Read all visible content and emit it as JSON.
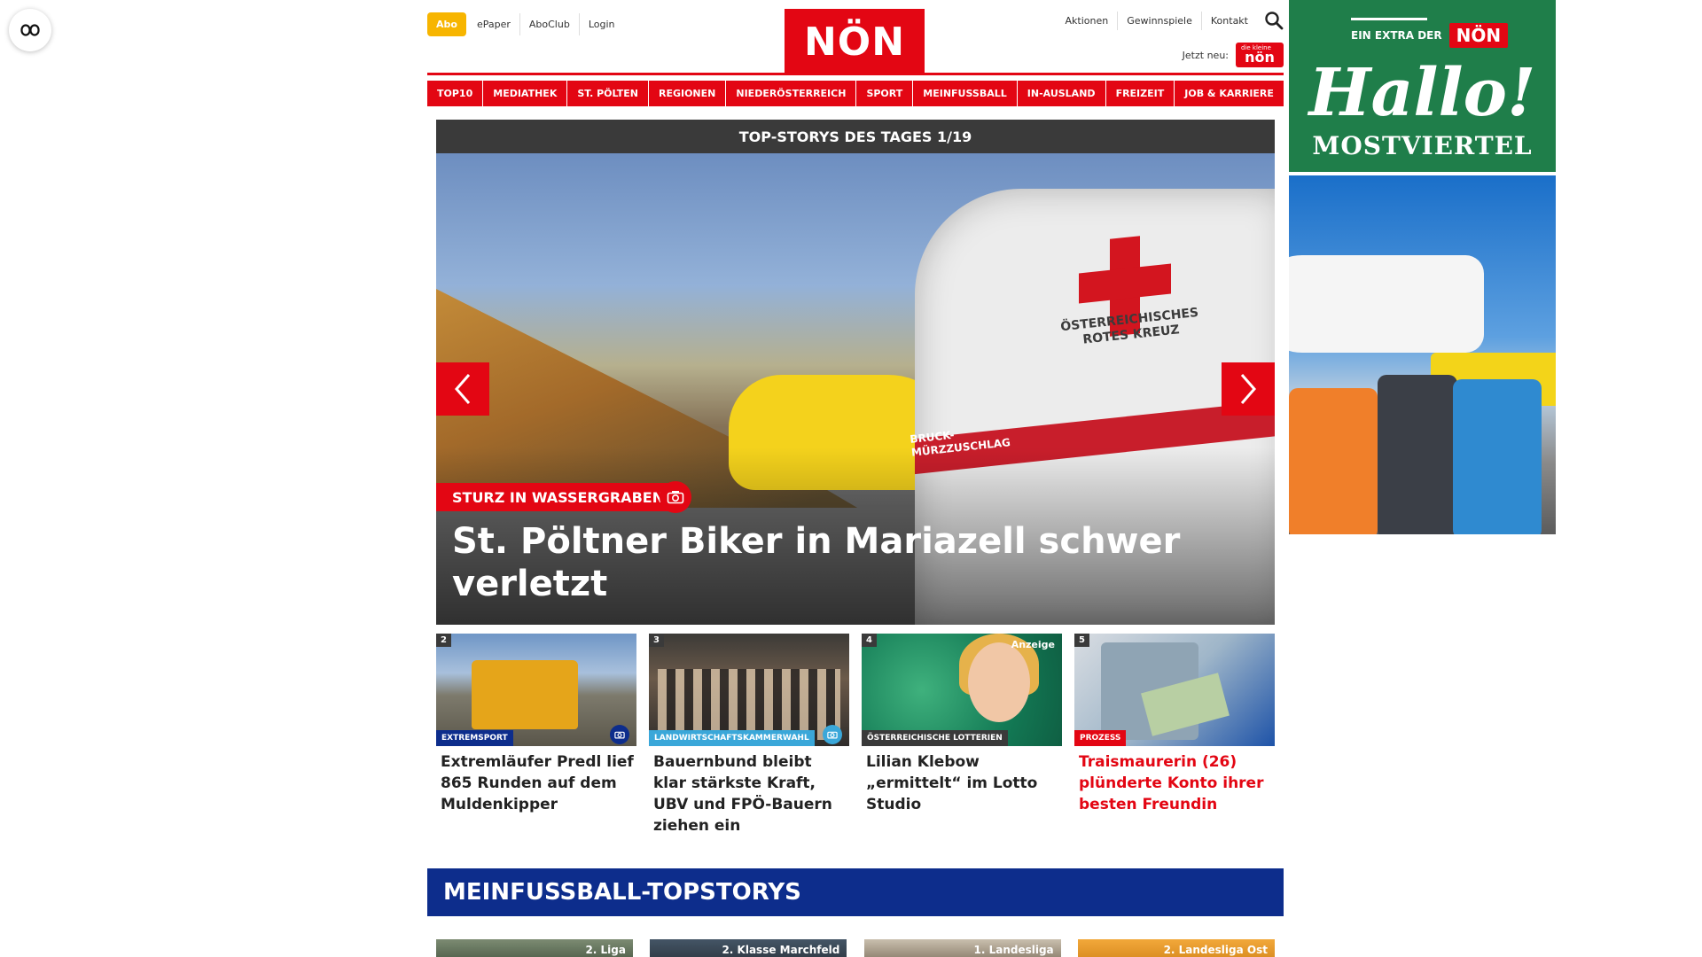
{
  "header": {
    "abo": "Abo",
    "left_links": [
      "ePaper",
      "AboClub",
      "Login"
    ],
    "logo": "NÖN",
    "right_links": [
      "Aktionen",
      "Gewinnspiele",
      "Kontakt"
    ],
    "jetzt_neu": "Jetzt neu:",
    "jetzt_badge": "nön",
    "jetzt_badge_small": "die kleine"
  },
  "nav": [
    "TOP10",
    "MEDIATHEK",
    "ST. PÖLTEN",
    "REGIONEN",
    "NIEDERÖSTERREICH",
    "SPORT",
    "MEINFUSSBALL",
    "IN-AUSLAND",
    "FREIZEIT",
    "JOB & KARRIERE"
  ],
  "hero": {
    "header": "TOP-STORYS DES TAGES 1/19",
    "tag": "STURZ IN WASSERGRABEN",
    "title": "St. Pöltner Biker in Mariazell schwer verletzt",
    "van_text": "ÖSTERREICHISCHES\nROTES KREUZ",
    "van_text2": "BRUCK-\nMÜRZZUSCHLAG"
  },
  "teasers": [
    {
      "num": "2",
      "category": "EXTREMSPORT",
      "title": "Extremläufer Predl lief 865 Runden auf dem Muldenkipper",
      "cat_color": "#0d2d8c",
      "title_color": "#222222",
      "photo": true
    },
    {
      "num": "3",
      "category": "LANDWIRTSCHAFTSKAMMERWAHL",
      "title": "Bauernbund bleibt klar stärkste Kraft, UBV und FPÖ-Bauern ziehen ein",
      "cat_color": "#3aa7d9",
      "title_color": "#222222",
      "photo": true
    },
    {
      "num": "4",
      "category": "ÖSTERREICHISCHE LOTTERIEN",
      "title": "Lilian Klebow „ermittelt“ im Lotto Studio",
      "anzeige": "Anzeige",
      "cat_color": "#3a3a3a",
      "title_color": "#222222",
      "photo": false
    },
    {
      "num": "5",
      "category": "PROZESS",
      "title": "Traismaurerin (26) plünderte Konto ihrer besten Freundin",
      "cat_color": "#e30613",
      "title_color": "#e30613",
      "photo": false
    }
  ],
  "section": {
    "title": "MEINFUSSBALL-TOPSTORYS",
    "teaser_labels": [
      "2. Liga",
      "2. Klasse Marchfeld",
      "1. Landesliga",
      "2. Landesliga Ost"
    ]
  },
  "ads": {
    "extra_label": "EIN EXTRA DER",
    "extra_logo": "NÖN",
    "hallo": "Hallo!",
    "region": "MOSTVIERTEL"
  },
  "colors": {
    "brand_red": "#e30613",
    "abo_yellow": "#f7b500",
    "section_blue": "#0d2d8c",
    "ad_green": "#1f7e4a"
  }
}
